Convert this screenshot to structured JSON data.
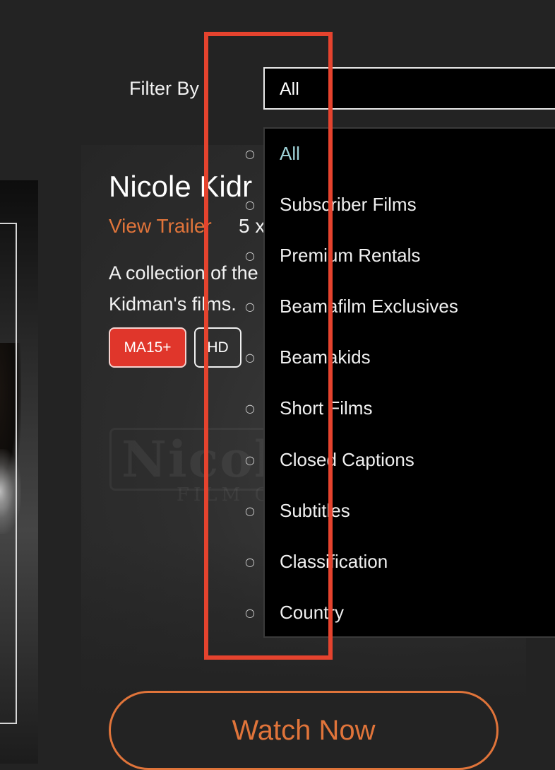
{
  "filter": {
    "label": "Filter By",
    "selected_value": "All",
    "options": [
      "All",
      "Subscriber Films",
      "Premium Rentals",
      "Beamafilm Exclusives",
      "Beamakids",
      "Short Films",
      "Closed Captions",
      "Subtitles",
      "Classification",
      "Country"
    ],
    "selected_color": "#9fd3d8"
  },
  "collection": {
    "title": "Nicole Kidr",
    "trailer_label": "View Trailer",
    "film_count": "5 x",
    "description": "A collection of the Kidman's films.",
    "rating_badge": "MA15+",
    "quality_badge": "HD",
    "watch_label": "Watch Now",
    "watermark_title": "Nicole",
    "watermark_subtitle": "FILM C"
  },
  "colors": {
    "accent": "#e0743a",
    "rating_red": "#e0362b",
    "highlight_red": "#e5432e",
    "background": "#232323"
  }
}
